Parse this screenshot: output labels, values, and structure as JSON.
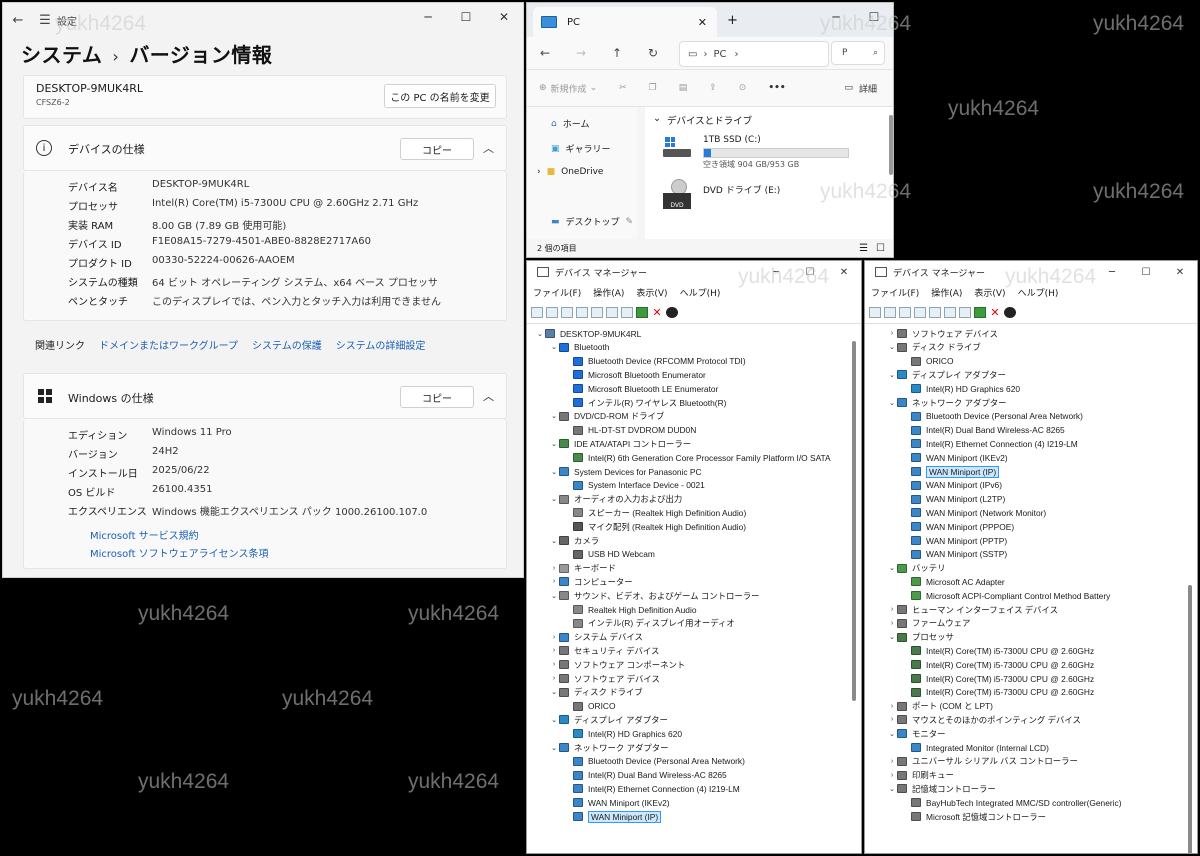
{
  "watermark": "yukh4264",
  "settings": {
    "app_title": "設定",
    "breadcrumb_parent": "システム",
    "breadcrumb_sep": "›",
    "breadcrumb_current": "バージョン情報",
    "pc_name": "DESKTOP-9MUK4RL",
    "pc_model": "CFSZ6-2",
    "rename_button": "この PC の名前を変更",
    "device_spec_title": "デバイスの仕様",
    "copy_label": "コピー",
    "device_specs": [
      {
        "k": "デバイス名",
        "v": "DESKTOP-9MUK4RL"
      },
      {
        "k": "プロセッサ",
        "v": "Intel(R) Core(TM) i5-7300U CPU @ 2.60GHz   2.71 GHz"
      },
      {
        "k": "実装 RAM",
        "v": "8.00 GB (7.89 GB 使用可能)"
      },
      {
        "k": "デバイス ID",
        "v": "F1E08A15-7279-4501-ABE0-8828E2717A60"
      },
      {
        "k": "プロダクト ID",
        "v": "00330-52224-00626-AAOEM"
      },
      {
        "k": "システムの種類",
        "v": "64 ビット オペレーティング システム、x64 ベース プロセッサ"
      },
      {
        "k": "ペンとタッチ",
        "v": "このディスプレイでは、ペン入力とタッチ入力は利用できません"
      }
    ],
    "related_label": "関連リンク",
    "related_links": [
      "ドメインまたはワークグループ",
      "システムの保護",
      "システムの詳細設定"
    ],
    "windows_spec_title": "Windows の仕様",
    "windows_specs": [
      {
        "k": "エディション",
        "v": "Windows 11 Pro"
      },
      {
        "k": "バージョン",
        "v": "24H2"
      },
      {
        "k": "インストール日",
        "v": "2025/06/22"
      },
      {
        "k": "OS ビルド",
        "v": "26100.4351"
      },
      {
        "k": "エクスペリエンス",
        "v": "Windows 機能エクスペリエンス パック 1000.26100.107.0"
      }
    ],
    "ms_links": [
      "Microsoft サービス規約",
      "Microsoft ソフトウェアライセンス条項"
    ]
  },
  "explorer": {
    "tab_title": "PC",
    "address_text": "PC",
    "search_placeholder": "P",
    "new_label": "新規作成",
    "details_label": "詳細",
    "nav_items": [
      "ホーム",
      "ギャラリー",
      "OneDrive",
      "デスクトップ"
    ],
    "section_label": "デバイスとドライブ",
    "drive1_name": "1TB SSD (C:)",
    "drive1_free": "空き領域 904 GB/953 GB",
    "drive1_used_fraction": 0.05,
    "drive2_name": "DVD ドライブ (E:)",
    "drive2_badge": "DVD",
    "status": "2 個の項目"
  },
  "devmgr_title": "デバイス マネージャー",
  "devmgr_menu": [
    "ファイル(F)",
    "操作(A)",
    "表示(V)",
    "ヘルプ(H)"
  ],
  "dm1_tree": [
    {
      "t": "DESKTOP-9MUK4RL",
      "l": 0,
      "e": "v",
      "c": "#5a7fa8"
    },
    {
      "t": "Bluetooth",
      "l": 1,
      "e": "v",
      "c": "#1e6fd9"
    },
    {
      "t": "Bluetooth Device (RFCOMM Protocol TDI)",
      "l": 2,
      "c": "#1e6fd9"
    },
    {
      "t": "Microsoft Bluetooth Enumerator",
      "l": 2,
      "c": "#1e6fd9"
    },
    {
      "t": "Microsoft Bluetooth LE Enumerator",
      "l": 2,
      "c": "#1e6fd9"
    },
    {
      "t": "インテル(R) ワイヤレス Bluetooth(R)",
      "l": 2,
      "c": "#1e6fd9"
    },
    {
      "t": "DVD/CD-ROM ドライブ",
      "l": 1,
      "e": "v",
      "c": "#777"
    },
    {
      "t": "HL-DT-ST DVDROM DUD0N",
      "l": 2,
      "c": "#777"
    },
    {
      "t": "IDE ATA/ATAPI コントローラー",
      "l": 1,
      "e": "v",
      "c": "#4a8a4a"
    },
    {
      "t": "Intel(R) 6th Generation Core Processor Family Platform I/O SATA",
      "l": 2,
      "c": "#4a8a4a"
    },
    {
      "t": "System Devices for Panasonic PC",
      "l": 1,
      "e": "v",
      "c": "#3a86c8"
    },
    {
      "t": "System Interface Device - 0021",
      "l": 2,
      "c": "#3a86c8"
    },
    {
      "t": "オーディオの入力および出力",
      "l": 1,
      "e": "v",
      "c": "#888"
    },
    {
      "t": "スピーカー (Realtek High Definition Audio)",
      "l": 2,
      "c": "#888"
    },
    {
      "t": "マイク配列 (Realtek High Definition Audio)",
      "l": 2,
      "c": "#555"
    },
    {
      "t": "カメラ",
      "l": 1,
      "e": "v",
      "c": "#666"
    },
    {
      "t": "USB HD Webcam",
      "l": 2,
      "c": "#666"
    },
    {
      "t": "キーボード",
      "l": 1,
      "e": ">",
      "c": "#999"
    },
    {
      "t": "コンピューター",
      "l": 1,
      "e": ">",
      "c": "#3a86c8"
    },
    {
      "t": "サウンド、ビデオ、およびゲーム コントローラー",
      "l": 1,
      "e": "v",
      "c": "#888"
    },
    {
      "t": "Realtek High Definition Audio",
      "l": 2,
      "c": "#888"
    },
    {
      "t": "インテル(R) ディスプレイ用オーディオ",
      "l": 2,
      "c": "#888"
    },
    {
      "t": "システム デバイス",
      "l": 1,
      "e": ">",
      "c": "#3a86c8"
    },
    {
      "t": "セキュリティ デバイス",
      "l": 1,
      "e": ">",
      "c": "#777"
    },
    {
      "t": "ソフトウェア コンポーネント",
      "l": 1,
      "e": ">",
      "c": "#777"
    },
    {
      "t": "ソフトウェア デバイス",
      "l": 1,
      "e": ">",
      "c": "#777"
    },
    {
      "t": "ディスク ドライブ",
      "l": 1,
      "e": "v",
      "c": "#777"
    },
    {
      "t": "ORICO",
      "l": 2,
      "c": "#777"
    },
    {
      "t": "ディスプレイ アダプター",
      "l": 1,
      "e": "v",
      "c": "#2a8ac8"
    },
    {
      "t": "Intel(R) HD Graphics 620",
      "l": 2,
      "c": "#2a8ac8"
    },
    {
      "t": "ネットワーク アダプター",
      "l": 1,
      "e": "v",
      "c": "#3a86c8"
    },
    {
      "t": "Bluetooth Device (Personal Area Network)",
      "l": 2,
      "c": "#3a86c8"
    },
    {
      "t": "Intel(R) Dual Band Wireless-AC 8265",
      "l": 2,
      "c": "#3a86c8"
    },
    {
      "t": "Intel(R) Ethernet Connection (4) I219-LM",
      "l": 2,
      "c": "#3a86c8"
    },
    {
      "t": "WAN Miniport (IKEv2)",
      "l": 2,
      "c": "#3a86c8"
    },
    {
      "t": "WAN Miniport (IP)",
      "l": 2,
      "c": "#3a86c8",
      "s": true
    }
  ],
  "dm2_tree": [
    {
      "t": "ソフトウェア デバイス",
      "l": 1,
      "e": ">",
      "c": "#777"
    },
    {
      "t": "ディスク ドライブ",
      "l": 1,
      "e": "v",
      "c": "#777"
    },
    {
      "t": "ORICO",
      "l": 2,
      "c": "#777"
    },
    {
      "t": "ディスプレイ アダプター",
      "l": 1,
      "e": "v",
      "c": "#2a8ac8"
    },
    {
      "t": "Intel(R) HD Graphics 620",
      "l": 2,
      "c": "#2a8ac8"
    },
    {
      "t": "ネットワーク アダプター",
      "l": 1,
      "e": "v",
      "c": "#3a86c8"
    },
    {
      "t": "Bluetooth Device (Personal Area Network)",
      "l": 2,
      "c": "#3a86c8"
    },
    {
      "t": "Intel(R) Dual Band Wireless-AC 8265",
      "l": 2,
      "c": "#3a86c8"
    },
    {
      "t": "Intel(R) Ethernet Connection (4) I219-LM",
      "l": 2,
      "c": "#3a86c8"
    },
    {
      "t": "WAN Miniport (IKEv2)",
      "l": 2,
      "c": "#3a86c8"
    },
    {
      "t": "WAN Miniport (IP)",
      "l": 2,
      "c": "#3a86c8",
      "s": true
    },
    {
      "t": "WAN Miniport (IPv6)",
      "l": 2,
      "c": "#3a86c8"
    },
    {
      "t": "WAN Miniport (L2TP)",
      "l": 2,
      "c": "#3a86c8"
    },
    {
      "t": "WAN Miniport (Network Monitor)",
      "l": 2,
      "c": "#3a86c8"
    },
    {
      "t": "WAN Miniport (PPPOE)",
      "l": 2,
      "c": "#3a86c8"
    },
    {
      "t": "WAN Miniport (PPTP)",
      "l": 2,
      "c": "#3a86c8"
    },
    {
      "t": "WAN Miniport (SSTP)",
      "l": 2,
      "c": "#3a86c8"
    },
    {
      "t": "バッテリ",
      "l": 1,
      "e": "v",
      "c": "#4a9a4a"
    },
    {
      "t": "Microsoft AC Adapter",
      "l": 2,
      "c": "#4a9a4a"
    },
    {
      "t": "Microsoft ACPI-Compliant Control Method Battery",
      "l": 2,
      "c": "#4a9a4a"
    },
    {
      "t": "ヒューマン インターフェイス デバイス",
      "l": 1,
      "e": ">",
      "c": "#777"
    },
    {
      "t": "ファームウェア",
      "l": 1,
      "e": ">",
      "c": "#777"
    },
    {
      "t": "プロセッサ",
      "l": 1,
      "e": "v",
      "c": "#4a7a4a"
    },
    {
      "t": "Intel(R) Core(TM) i5-7300U CPU @ 2.60GHz",
      "l": 2,
      "c": "#4a7a4a"
    },
    {
      "t": "Intel(R) Core(TM) i5-7300U CPU @ 2.60GHz",
      "l": 2,
      "c": "#4a7a4a"
    },
    {
      "t": "Intel(R) Core(TM) i5-7300U CPU @ 2.60GHz",
      "l": 2,
      "c": "#4a7a4a"
    },
    {
      "t": "Intel(R) Core(TM) i5-7300U CPU @ 2.60GHz",
      "l": 2,
      "c": "#4a7a4a"
    },
    {
      "t": "ポート (COM と LPT)",
      "l": 1,
      "e": ">",
      "c": "#777"
    },
    {
      "t": "マウスとそのほかのポインティング デバイス",
      "l": 1,
      "e": ">",
      "c": "#777"
    },
    {
      "t": "モニター",
      "l": 1,
      "e": "v",
      "c": "#3a86c8"
    },
    {
      "t": "Integrated Monitor (Internal LCD)",
      "l": 2,
      "c": "#3a86c8"
    },
    {
      "t": "ユニバーサル シリアル バス コントローラー",
      "l": 1,
      "e": ">",
      "c": "#777"
    },
    {
      "t": "印刷キュー",
      "l": 1,
      "e": ">",
      "c": "#777"
    },
    {
      "t": "記憶域コントローラー",
      "l": 1,
      "e": "v",
      "c": "#777"
    },
    {
      "t": "BayHubTech Integrated MMC/SD controller(Generic)",
      "l": 2,
      "c": "#777"
    },
    {
      "t": "Microsoft 記憶域コントローラー",
      "l": 2,
      "c": "#777"
    }
  ]
}
